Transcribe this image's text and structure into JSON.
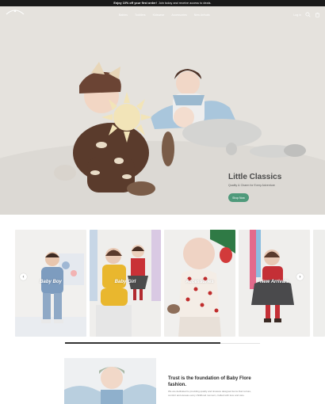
{
  "announcement": {
    "bold": "Enjoy 10% off your first order!",
    "text": "Join today and receive access to deals."
  },
  "header": {
    "logo_text": "baby flore",
    "nav": [
      "Babies",
      "Toddlers",
      "Kidswear",
      "Accessories",
      "New Arrivals"
    ],
    "login": "Log in"
  },
  "hero": {
    "title": "Little Classics",
    "subtitle": "Quality & Charm for Every Adventure",
    "button": "Shop Now"
  },
  "categories": [
    {
      "label": "Baby Boy"
    },
    {
      "label": "Baby Girl"
    },
    {
      "label": "Accessories"
    },
    {
      "label": "New Arrivals"
    }
  ],
  "carousel": {
    "prev": "‹",
    "next": "›"
  },
  "about": {
    "title": "Trust is the foundation of Baby Flore fashion.",
    "text": "We are dedicated to providing quality and timeless designed items that nurture, comfort and elevate every childhood moment, crafted with love and care."
  },
  "colors": {
    "accent": "#4f9a7b",
    "announcement_bg": "#1a1a1a"
  }
}
